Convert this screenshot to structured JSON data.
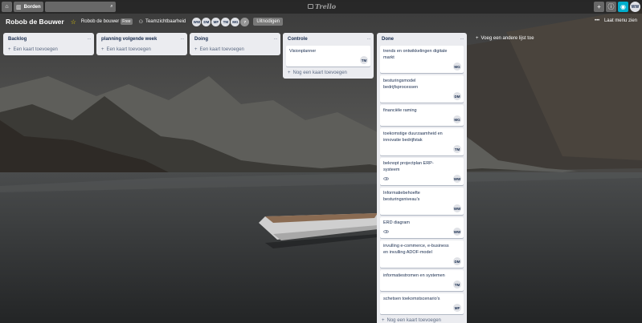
{
  "topbar": {
    "home_icon": "home-icon",
    "boards_label": "Borden",
    "logo_text": "Trello"
  },
  "board": {
    "title": "Robob de Bouwer",
    "team_name": "Robob de bouwer",
    "plan_badge": "Free",
    "visibility": "Teamzichtbaarheid",
    "members": [
      "WW",
      "DM",
      "MF",
      "TM",
      "MG",
      "7"
    ],
    "invite_label": "Uitnodigen",
    "menu_label": "Laat menu zien"
  },
  "user_initials": "WW",
  "lists": [
    {
      "title": "Backlog",
      "add_card": "Een kaart toevoegen",
      "cards": []
    },
    {
      "title": "planning volgende week",
      "add_card": "Een kaart toevoegen",
      "cards": []
    },
    {
      "title": "Doing",
      "add_card": "Een kaart toevoegen",
      "cards": []
    },
    {
      "title": "Controle",
      "add_card": "Nog een kaart toevoegen",
      "cards": [
        {
          "text": "Visionplanner",
          "member": "TM",
          "watch": false
        }
      ]
    },
    {
      "title": "Done",
      "add_card": "Nog een kaart toevoegen",
      "cards": [
        {
          "text": "trends en ontwikkelingen digitale markt",
          "member": "MG",
          "watch": false
        },
        {
          "text": "besturingsmodel bedrijfsprocessen",
          "member": "DM",
          "watch": false
        },
        {
          "text": "financiële raming",
          "member": "MG",
          "watch": false
        },
        {
          "text": "toekomstige duurzaamheid en innovatie bedrijfstak",
          "member": "TM",
          "watch": false
        },
        {
          "text": "beknopt projectplan ERP-systeem",
          "member": "WW",
          "watch": true
        },
        {
          "text": "Informatiebehoefte besturingsniveau's",
          "member": "WW",
          "watch": false
        },
        {
          "text": "ERD diagram",
          "member": "WW",
          "watch": true
        },
        {
          "text": "invulling e-commerce, e-business en invulling ADOF-model",
          "member": "DM",
          "watch": false
        },
        {
          "text": "informatiestromen en systemen",
          "member": "TM",
          "watch": false
        },
        {
          "text": "schetsen toekomstscenario's",
          "member": "MF",
          "watch": false
        }
      ]
    }
  ],
  "add_list_label": "Voeg een andere lijst toe",
  "colors": {
    "accent": "#00aecc",
    "list_bg": "#ebecf0",
    "star": "#f2d600"
  }
}
